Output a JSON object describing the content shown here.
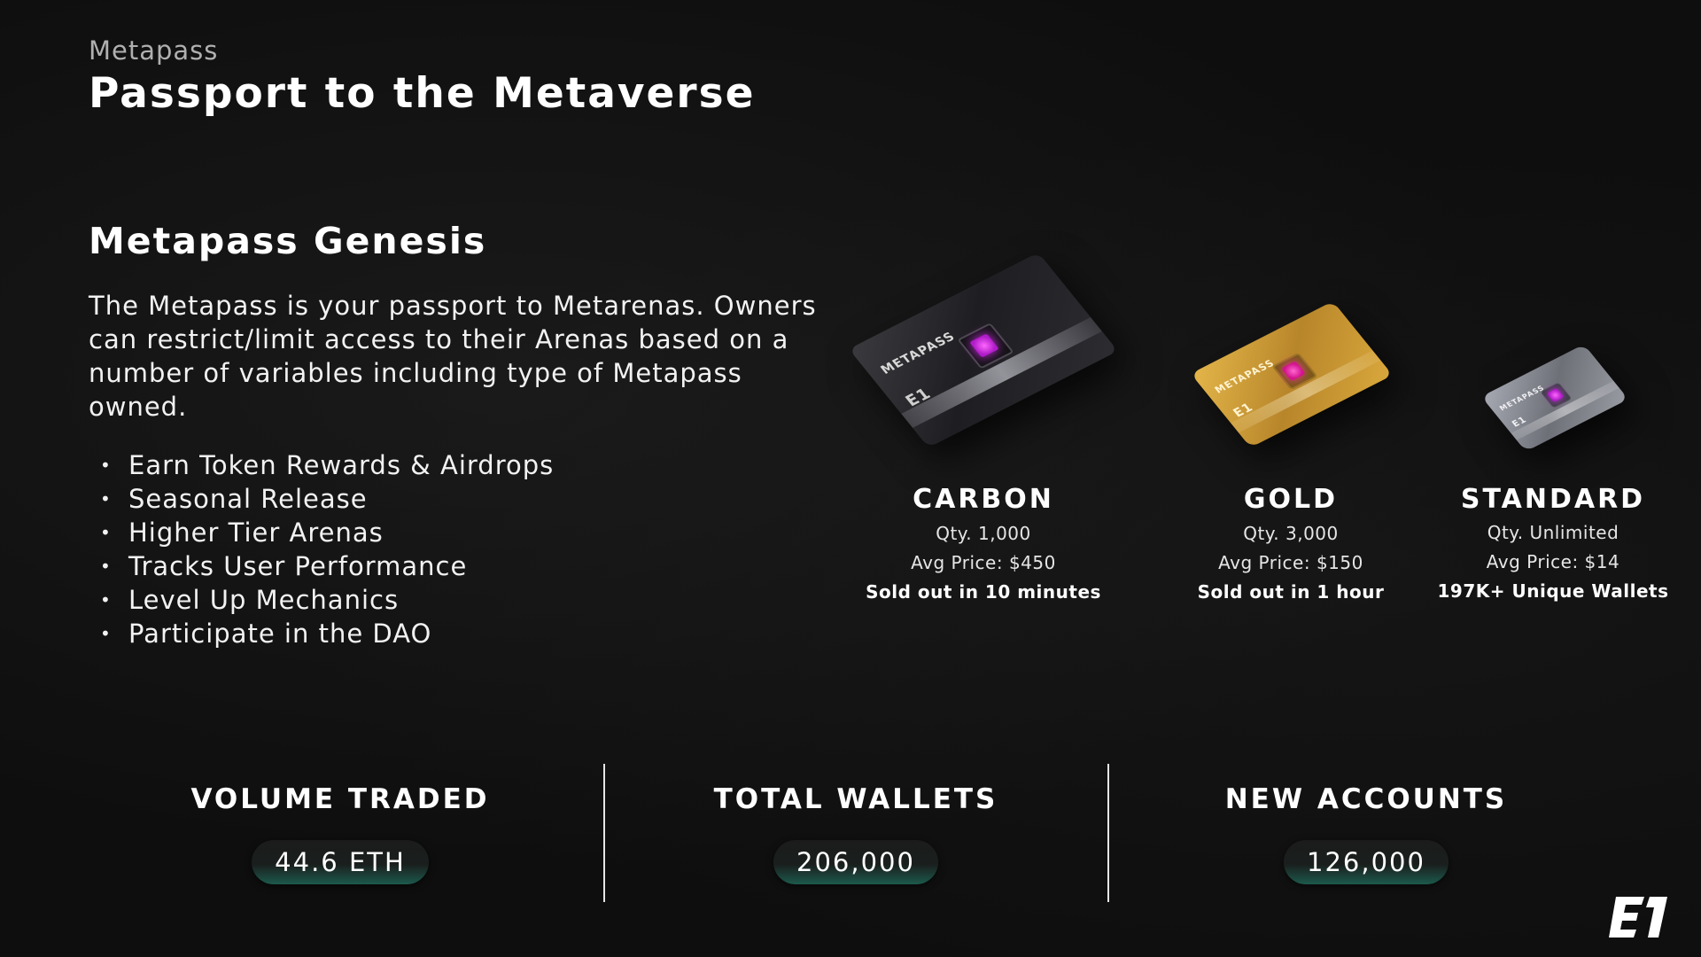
{
  "header": {
    "eyebrow": "Metapass",
    "title": "Passport to the Metaverse"
  },
  "genesis": {
    "title": "Metapass Genesis",
    "description": "The Metapass is your passport to Metarenas. Owners can restrict/limit access to their Arenas based on a number of variables including type of Metapass owned.",
    "features": [
      "Earn Token Rewards & Airdrops",
      "Seasonal Release",
      "Higher Tier Arenas",
      "Tracks User Performance",
      "Level Up Mechanics",
      "Participate in the DAO"
    ]
  },
  "tiers": [
    {
      "name": "CARBON",
      "qty": "Qty. 1,000",
      "price": "Avg Price: $450",
      "note": "Sold out in 10 minutes",
      "card_brand": "METAPASS",
      "card_color": "#2a2a2e"
    },
    {
      "name": "GOLD",
      "qty": "Qty. 3,000",
      "price": "Avg Price: $150",
      "note": "Sold out in 1 hour",
      "card_brand": "METAPASS",
      "card_color": "#c99a2e"
    },
    {
      "name": "STANDARD",
      "qty": "Qty. Unlimited",
      "price": "Avg Price: $14",
      "note": "197K+ Unique Wallets",
      "card_brand": "METAPASS",
      "card_color": "#8a8c94"
    }
  ],
  "stats": [
    {
      "label": "VOLUME TRADED",
      "value": "44.6 ETH"
    },
    {
      "label": "TOTAL WALLETS",
      "value": "206,000"
    },
    {
      "label": "NEW ACCOUNTS",
      "value": "126,000"
    }
  ],
  "logo": {
    "icon": "e1-logo-icon"
  },
  "colors": {
    "background": "#0e0e0e",
    "text": "#ffffff",
    "accent_pill": "#1d5a4c",
    "chip": "#c025d6"
  }
}
